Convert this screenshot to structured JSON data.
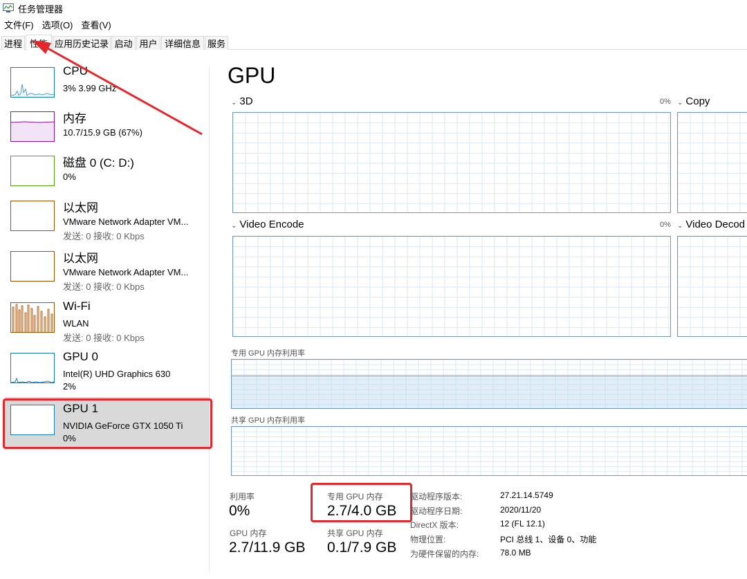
{
  "window": {
    "title": "任务管理器"
  },
  "menu": [
    "文件(F)",
    "选项(O)",
    "查看(V)"
  ],
  "tabs": [
    {
      "label": "进程"
    },
    {
      "label": "性能"
    },
    {
      "label": "应用历史记录"
    },
    {
      "label": "启动"
    },
    {
      "label": "用户"
    },
    {
      "label": "详细信息"
    },
    {
      "label": "服务"
    }
  ],
  "active_tab": "性能",
  "sidebar": {
    "items": [
      {
        "name": "CPU",
        "line2": "3% 3.99 GHz",
        "line3": "",
        "color": "#117dbb"
      },
      {
        "name": "内存",
        "line2": "10.7/15.9 GB (67%)",
        "line3": "",
        "color": "#8b12ae"
      },
      {
        "name": "磁盘 0 (C: D:)",
        "line2": "0%",
        "line3": "",
        "color": "#4da60c"
      },
      {
        "name": "以太网",
        "line2": "VMware Network Adapter VM...",
        "line3": "发送: 0 接收: 0 Kbps",
        "color": "#a74f01"
      },
      {
        "name": "以太网",
        "line2": "VMware Network Adapter VM...",
        "line3": "发送: 0 接收: 0 Kbps",
        "color": "#a74f01"
      },
      {
        "name": "Wi-Fi",
        "line2": "WLAN",
        "line3": "发送: 0 接收: 0 Kbps",
        "color": "#a74f01"
      },
      {
        "name": "GPU 0",
        "line2": "Intel(R) UHD Graphics 630",
        "line3": "2%",
        "color": "#117dbb"
      },
      {
        "name": "GPU 1",
        "line2": "NVIDIA GeForce GTX 1050 Ti",
        "line3": "0%",
        "color": "#117dbb"
      }
    ],
    "selected": "GPU 1"
  },
  "main": {
    "title": "GPU",
    "engines": [
      {
        "name": "3D",
        "percent": "0%"
      },
      {
        "name": "Copy",
        "percent": ""
      },
      {
        "name": "Video Encode",
        "percent": "0%"
      },
      {
        "name": "Video Decod",
        "percent": ""
      }
    ],
    "dedicated_mem_chart_label": "专用 GPU 内存利用率",
    "shared_mem_chart_label": "共享 GPU 内存利用率",
    "stats": {
      "utilization_label": "利用率",
      "utilization_value": "0%",
      "dedicated_label": "专用 GPU 内存",
      "dedicated_value": "2.7/4.0 GB",
      "gpu_mem_label": "GPU 内存",
      "gpu_mem_value": "2.7/11.9 GB",
      "shared_label": "共享 GPU 内存",
      "shared_value": "0.1/7.9 GB"
    },
    "info": [
      {
        "key": "驱动程序版本:",
        "value": "27.21.14.5749"
      },
      {
        "key": "驱动程序日期:",
        "value": "2020/11/20"
      },
      {
        "key": "DirectX 版本:",
        "value": "12 (FL 12.1)"
      },
      {
        "key": "物理位置:",
        "value": "PCI 总线 1、设备 0、功能"
      },
      {
        "key": "为硬件保留的内存:",
        "value": "78.0 MB"
      }
    ]
  },
  "colors": {
    "graph_border": "#6d97be",
    "grid": "#d9eaf4",
    "highlight": "#e6262a",
    "selected_bg": "#d9d9d9"
  }
}
